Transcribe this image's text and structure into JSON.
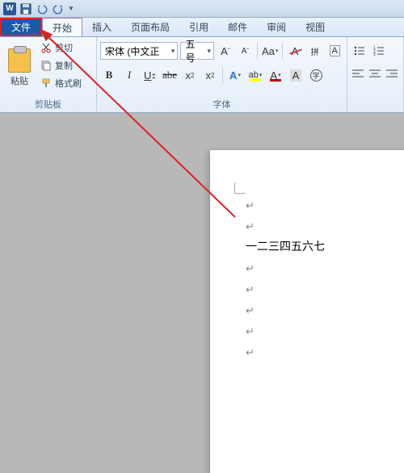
{
  "qat": {
    "app_letter": "W"
  },
  "tabs": {
    "file": "文件",
    "items": [
      "开始",
      "插入",
      "页面布局",
      "引用",
      "邮件",
      "审阅",
      "视图"
    ]
  },
  "ribbon": {
    "clipboard": {
      "paste": "粘贴",
      "cut": "剪切",
      "copy": "复制",
      "format_painter": "格式刷",
      "group_label": "剪贴板"
    },
    "font": {
      "font_name": "宋体 (中文正",
      "font_size": "五号",
      "grow": "A",
      "shrink": "A",
      "change_case": "Aa",
      "clear_format": "A",
      "phonetic": "拼",
      "char_border": "A",
      "bold": "B",
      "italic": "I",
      "underline": "U",
      "strike": "abe",
      "subscript": "x",
      "superscript": "x",
      "text_effect": "A",
      "highlight": "ab",
      "font_color": "A",
      "char_shading": "A",
      "enclose": "字",
      "group_label": "字体"
    }
  },
  "document": {
    "text_line": "一二三四五六七",
    "para_mark": "↵"
  },
  "annotation": {
    "highlight_target": "file-tab"
  }
}
